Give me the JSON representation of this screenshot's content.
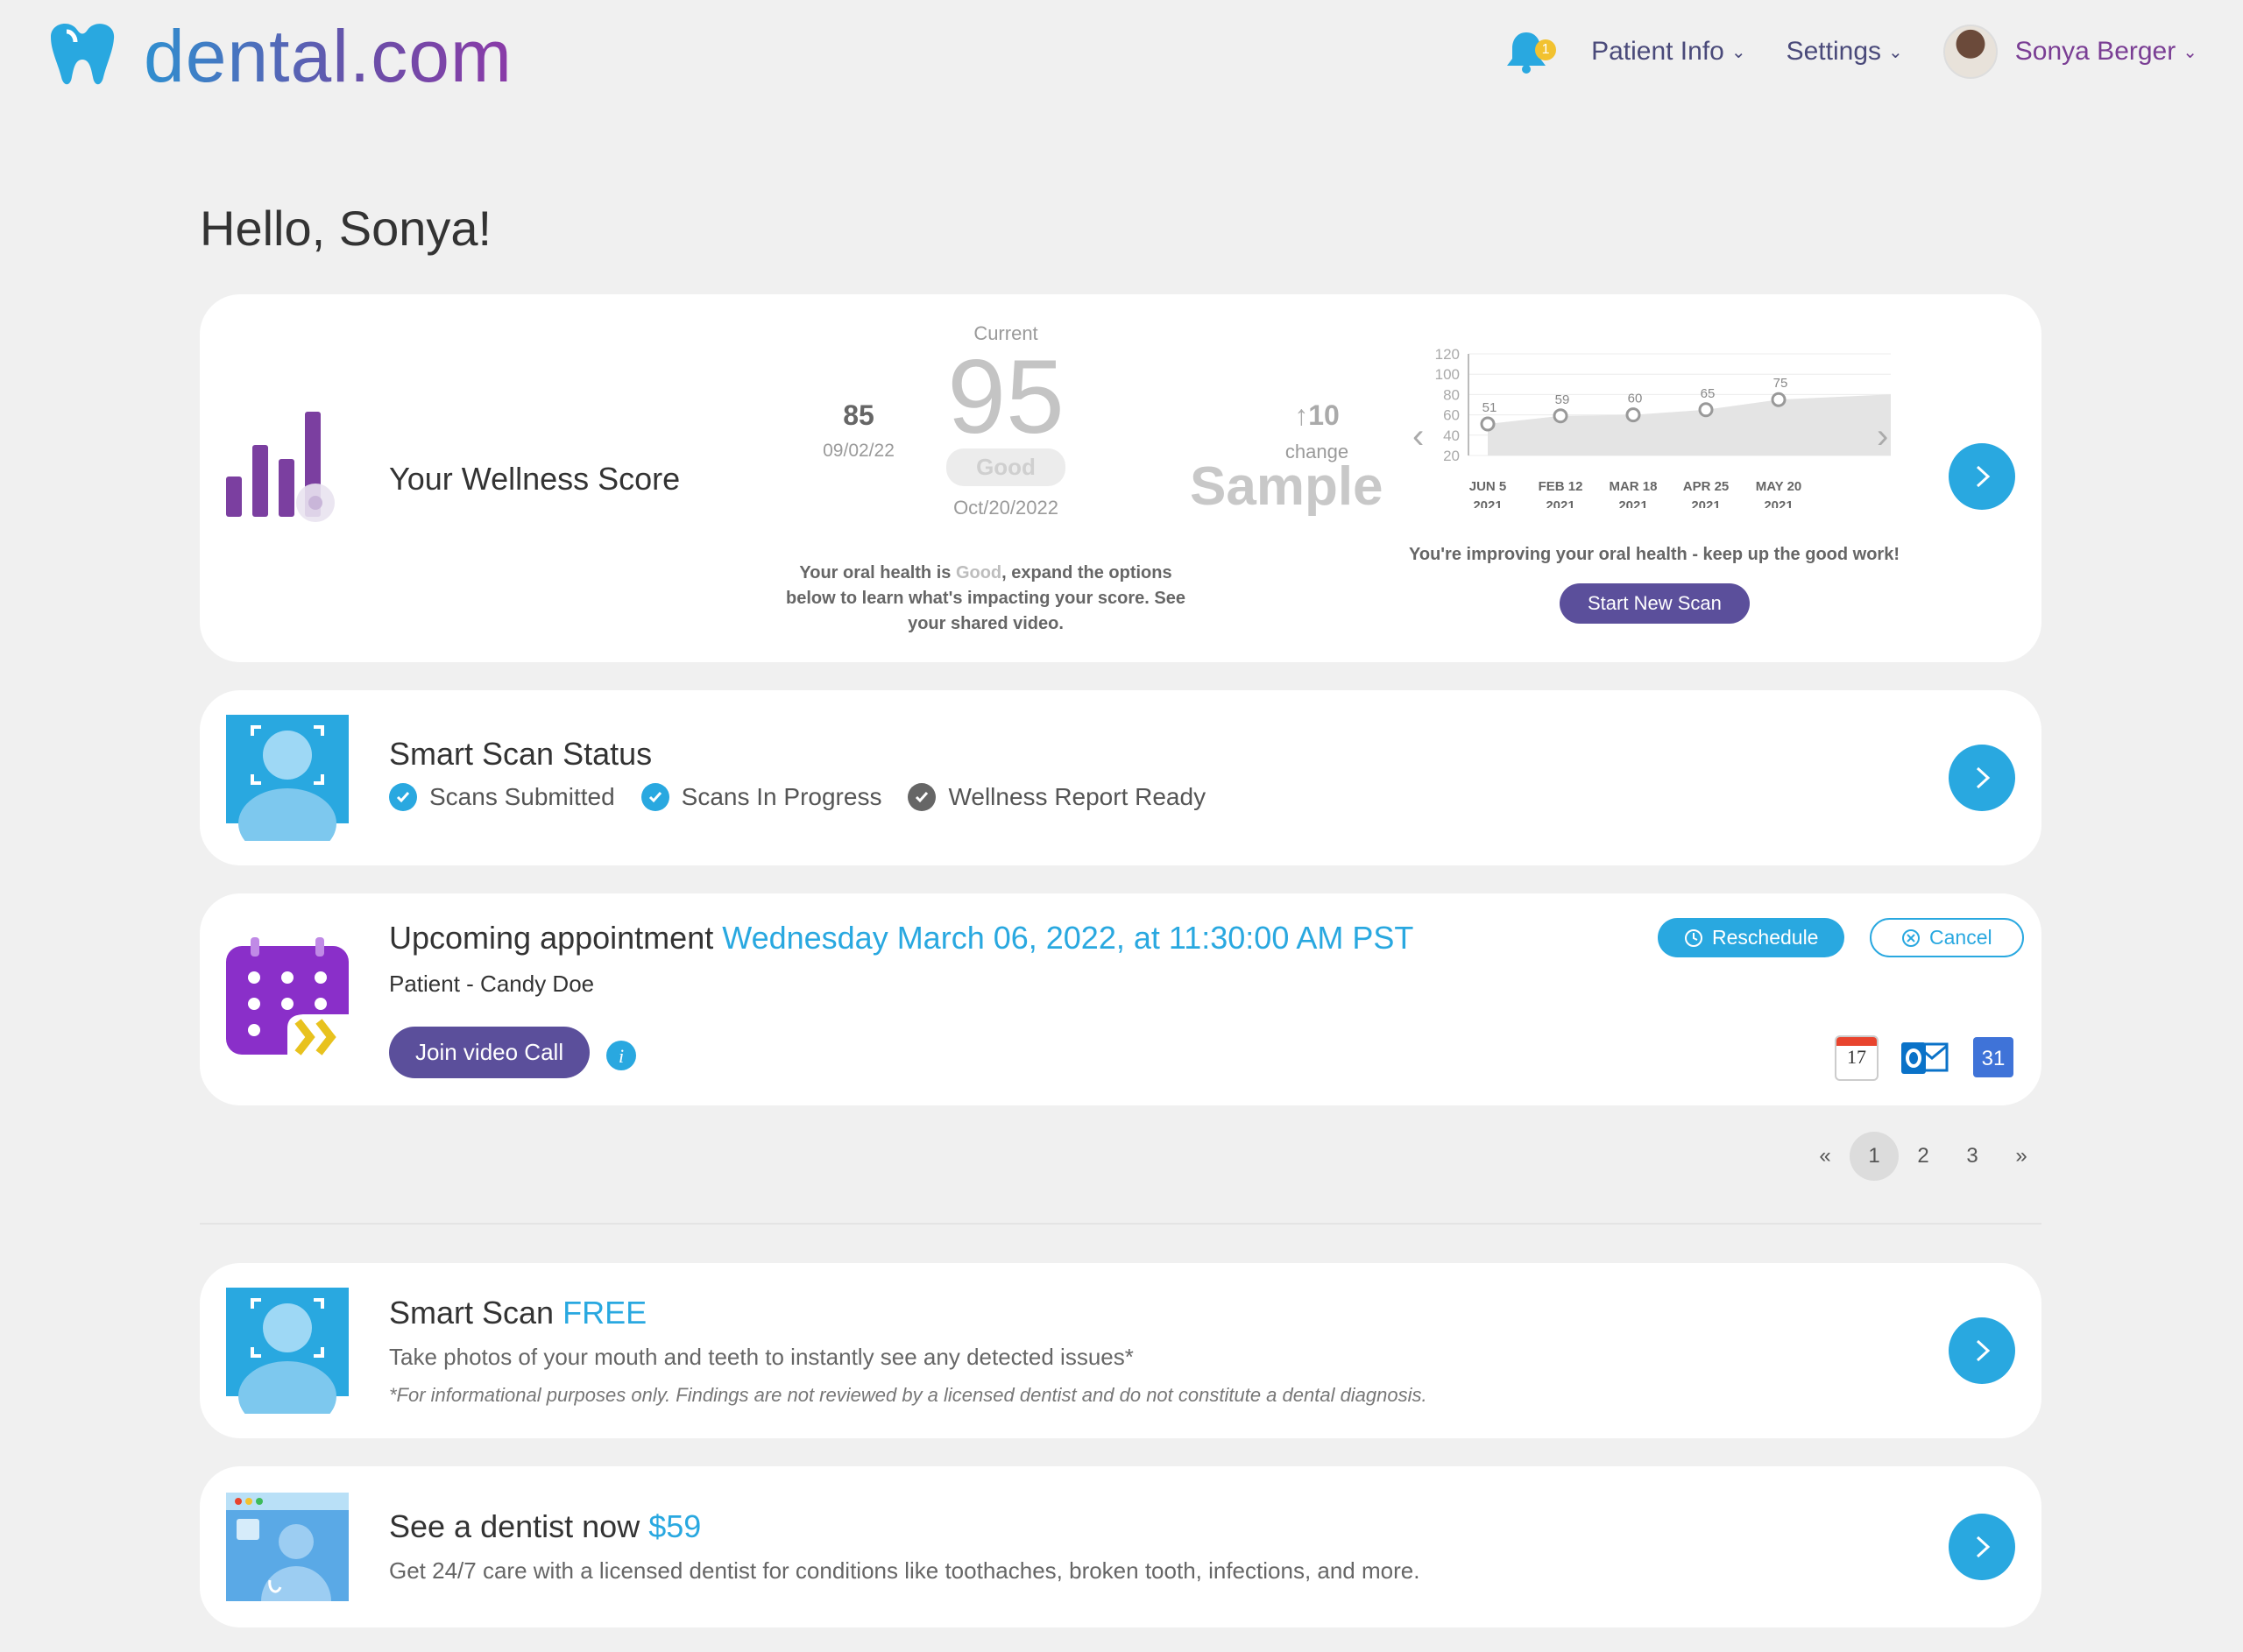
{
  "header": {
    "logo_text": "dental.com",
    "notification_count": "1",
    "nav": [
      {
        "label": "Patient Info"
      },
      {
        "label": "Settings"
      }
    ],
    "user_name": "Sonya Berger"
  },
  "greeting": "Hello, Sonya!",
  "wellness": {
    "title": "Your Wellness Score",
    "prev_score": "85",
    "prev_date": "09/02/22",
    "current_label": "Current",
    "current_score": "95",
    "rating": "Good",
    "current_date": "Oct/20/2022",
    "change_value": "↑10",
    "change_label": "change",
    "sample_label": "Sample",
    "desc_part1": "Your oral health is ",
    "desc_rating": "Good",
    "desc_part2": ", expand the options below to learn what's impacting your score. See your shared video.",
    "improving_text": "You're improving your oral health - keep up the good work!",
    "start_scan": "Start New Scan"
  },
  "chart_data": {
    "type": "area",
    "x": [
      "JUN 5 2021",
      "FEB 12 2021",
      "MAR 18 2021",
      "APR 25 2021",
      "MAY 20 2021"
    ],
    "x_lines": [
      [
        "JUN 5",
        "2021"
      ],
      [
        "FEB 12",
        "2021"
      ],
      [
        "MAR 18",
        "2021"
      ],
      [
        "APR 25",
        "2021"
      ],
      [
        "MAY 20",
        "2021"
      ]
    ],
    "values": [
      51,
      59,
      60,
      65,
      75
    ],
    "yticks": [
      120,
      100,
      80,
      60,
      40,
      20
    ],
    "ylim": [
      20,
      120
    ],
    "grid": true
  },
  "smart_scan_status": {
    "title": "Smart Scan Status",
    "steps": [
      {
        "label": "Scans Submitted"
      },
      {
        "label": "Scans In Progress"
      },
      {
        "label": "Wellness Report Ready"
      }
    ]
  },
  "appointment": {
    "title": "Upcoming appointment",
    "date": "Wednesday March 06, 2022, at 11:30:00 AM PST",
    "patient": "Patient - Candy Doe",
    "reschedule": "Reschedule",
    "cancel": "Cancel",
    "join": "Join video Call",
    "cal_apple": "17",
    "cal_google": "31"
  },
  "pagination": {
    "prev": "«",
    "pages": [
      "1",
      "2",
      "3"
    ],
    "next": "»"
  },
  "smart_scan_free": {
    "title": "Smart Scan ",
    "title_accent": "FREE",
    "subtitle": "Take photos of your mouth and teeth to instantly see any detected issues*",
    "note": "*For informational purposes only. Findings are not reviewed by a licensed dentist and do not constitute a dental diagnosis."
  },
  "dentist_now": {
    "title": "See a dentist now ",
    "price": "$59",
    "subtitle": "Get 24/7 care with a licensed dentist for conditions like toothaches, broken tooth, infections, and more."
  },
  "colors": {
    "accent": "#29a8e0",
    "primary": "#5b4f9b",
    "purple": "#8a2fc9"
  }
}
